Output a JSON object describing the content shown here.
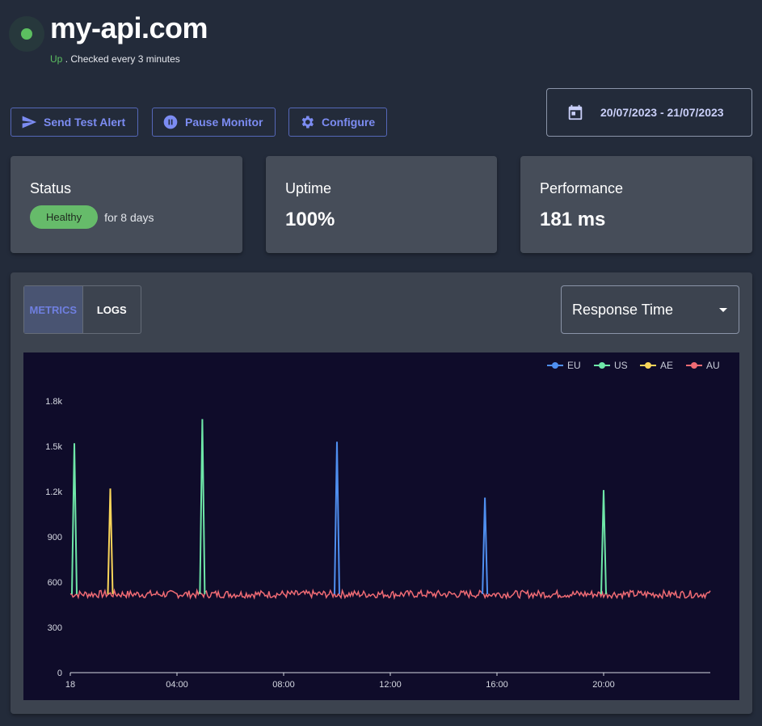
{
  "header": {
    "title": "my-api.com",
    "status": "Up",
    "check_text": ". Checked every 3 minutes"
  },
  "actions": {
    "send_test_alert": "Send Test Alert",
    "pause_monitor": "Pause Monitor",
    "configure": "Configure"
  },
  "date_range": "20/07/2023 - 21/07/2023",
  "cards": {
    "status": {
      "title": "Status",
      "badge": "Healthy",
      "since": "for 8 days"
    },
    "uptime": {
      "title": "Uptime",
      "value": "100%"
    },
    "performance": {
      "title": "Performance",
      "value": "181 ms"
    }
  },
  "tabs": {
    "metrics": "METRICS",
    "logs": "LOGS"
  },
  "metric_select": "Response Time",
  "colors": {
    "accent": "#7c8cf2",
    "healthy": "#66bb6a",
    "EU": "#4f8ff0",
    "US": "#6ee7a8",
    "AE": "#f9d55a",
    "AU": "#f06b74"
  },
  "chart_data": {
    "type": "line",
    "x_ticks": [
      "18",
      "04:00",
      "08:00",
      "12:00",
      "16:00",
      "20:00"
    ],
    "x_tick_hours": [
      0,
      4,
      8,
      12,
      16,
      20
    ],
    "x_range_hours": [
      0,
      24
    ],
    "y_ticks": [
      "0",
      "300",
      "600",
      "900",
      "1.2k",
      "1.5k",
      "1.8k"
    ],
    "y_tick_values": [
      0,
      300,
      600,
      900,
      1200,
      1500,
      1800
    ],
    "ylim": [
      0,
      1800
    ],
    "legend": [
      "EU",
      "US",
      "AE",
      "AU"
    ],
    "baseline_ms": 520,
    "series": [
      {
        "name": "EU",
        "spikes": [
          {
            "x_hours": 10.0,
            "y": 1530
          },
          {
            "x_hours": 15.55,
            "y": 1160
          }
        ]
      },
      {
        "name": "US",
        "spikes": [
          {
            "x_hours": 0.15,
            "y": 1520
          },
          {
            "x_hours": 4.95,
            "y": 1680
          },
          {
            "x_hours": 20.0,
            "y": 1210
          }
        ]
      },
      {
        "name": "AE",
        "spikes": [
          {
            "x_hours": 1.5,
            "y": 1220
          }
        ]
      },
      {
        "name": "AU",
        "spikes": []
      }
    ]
  }
}
